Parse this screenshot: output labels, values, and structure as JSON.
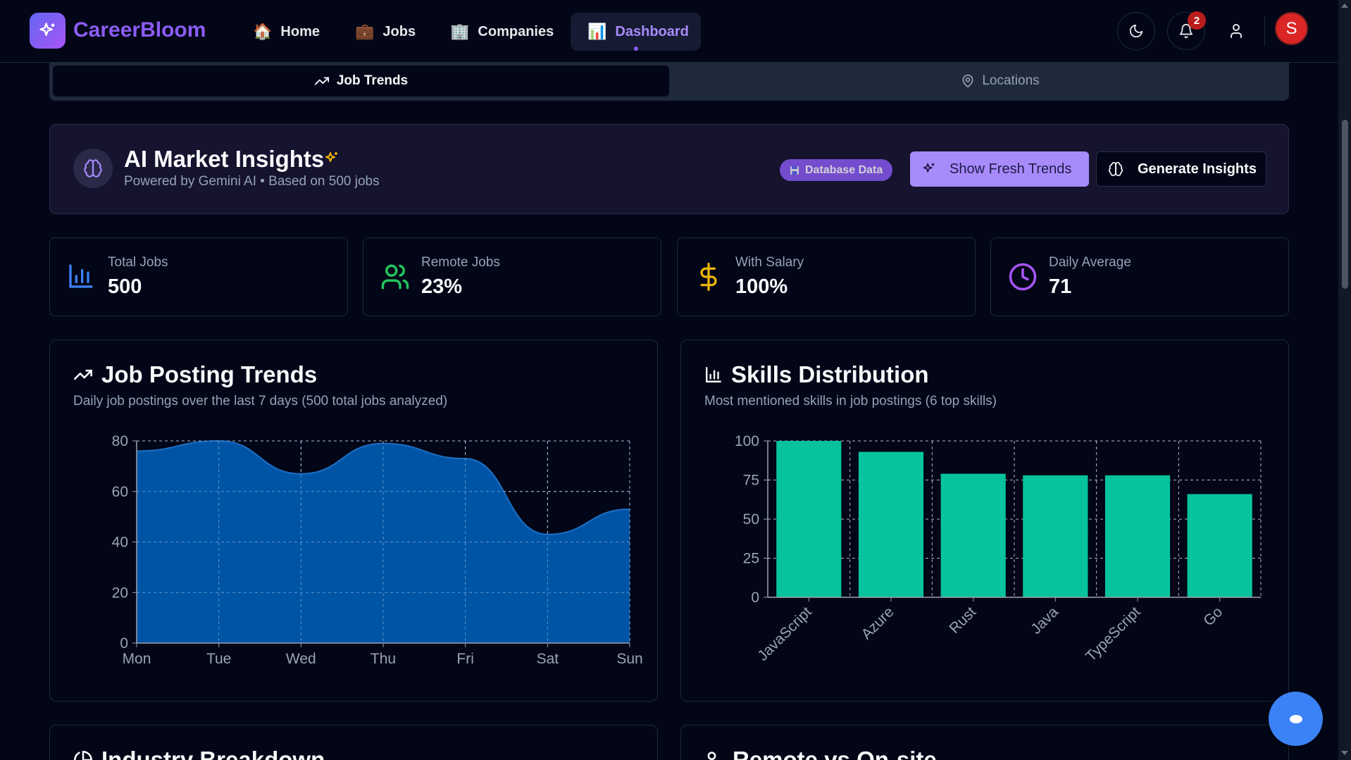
{
  "app": {
    "name": "CareerBloom"
  },
  "nav": {
    "items": [
      {
        "label": "Home",
        "emoji": "🏠"
      },
      {
        "label": "Jobs",
        "emoji": "💼"
      },
      {
        "label": "Companies",
        "emoji": "🏢"
      },
      {
        "label": "Dashboard",
        "emoji": "📊",
        "active": true
      }
    ],
    "notification_count": "2",
    "avatar_initial": "S"
  },
  "tabs": {
    "job_trends": "Job Trends",
    "locations": "Locations"
  },
  "ai_card": {
    "title": "AI Market Insights",
    "subtitle": "Powered by Gemini AI • Based on 500 jobs",
    "db_pill": "Database Data",
    "fresh_button": "Show Fresh Trends",
    "generate_button": "Generate Insights"
  },
  "stats": [
    {
      "label": "Total Jobs",
      "value": "500",
      "icon": "bar-chart-icon",
      "color": "#3b82f6"
    },
    {
      "label": "Remote Jobs",
      "value": "23%",
      "icon": "users-icon",
      "color": "#22c55e"
    },
    {
      "label": "With Salary",
      "value": "100%",
      "icon": "dollar-icon",
      "color": "#eab308"
    },
    {
      "label": "Daily Average",
      "value": "71",
      "icon": "clock-icon",
      "color": "#a855f7"
    }
  ],
  "trends": {
    "title": "Job Posting Trends",
    "subtitle": "Daily job postings over the last 7 days (500 total jobs analyzed)"
  },
  "skills": {
    "title": "Skills Distribution",
    "subtitle": "Most mentioned skills in job postings (6 top skills)"
  },
  "bottom": {
    "industry_title": "Industry Breakdown",
    "remote_title": "Remote vs On-site"
  },
  "chart_data": [
    {
      "type": "area",
      "categories": [
        "Mon",
        "Tue",
        "Wed",
        "Thu",
        "Fri",
        "Sat",
        "Sun"
      ],
      "values": [
        76,
        80,
        67,
        79,
        73,
        43,
        53
      ],
      "yticks": [
        0,
        20,
        40,
        60,
        80
      ],
      "ylim": [
        0,
        80
      ],
      "grid": true,
      "color": "#0059ad"
    },
    {
      "type": "bar",
      "categories": [
        "JavaScript",
        "Azure",
        "Rust",
        "Java",
        "TypeScript",
        "Go"
      ],
      "values": [
        100,
        93,
        79,
        78,
        78,
        66
      ],
      "yticks": [
        0,
        25,
        50,
        75,
        100
      ],
      "ylim": [
        0,
        100
      ],
      "grid": true,
      "color": "#06c39e"
    }
  ]
}
